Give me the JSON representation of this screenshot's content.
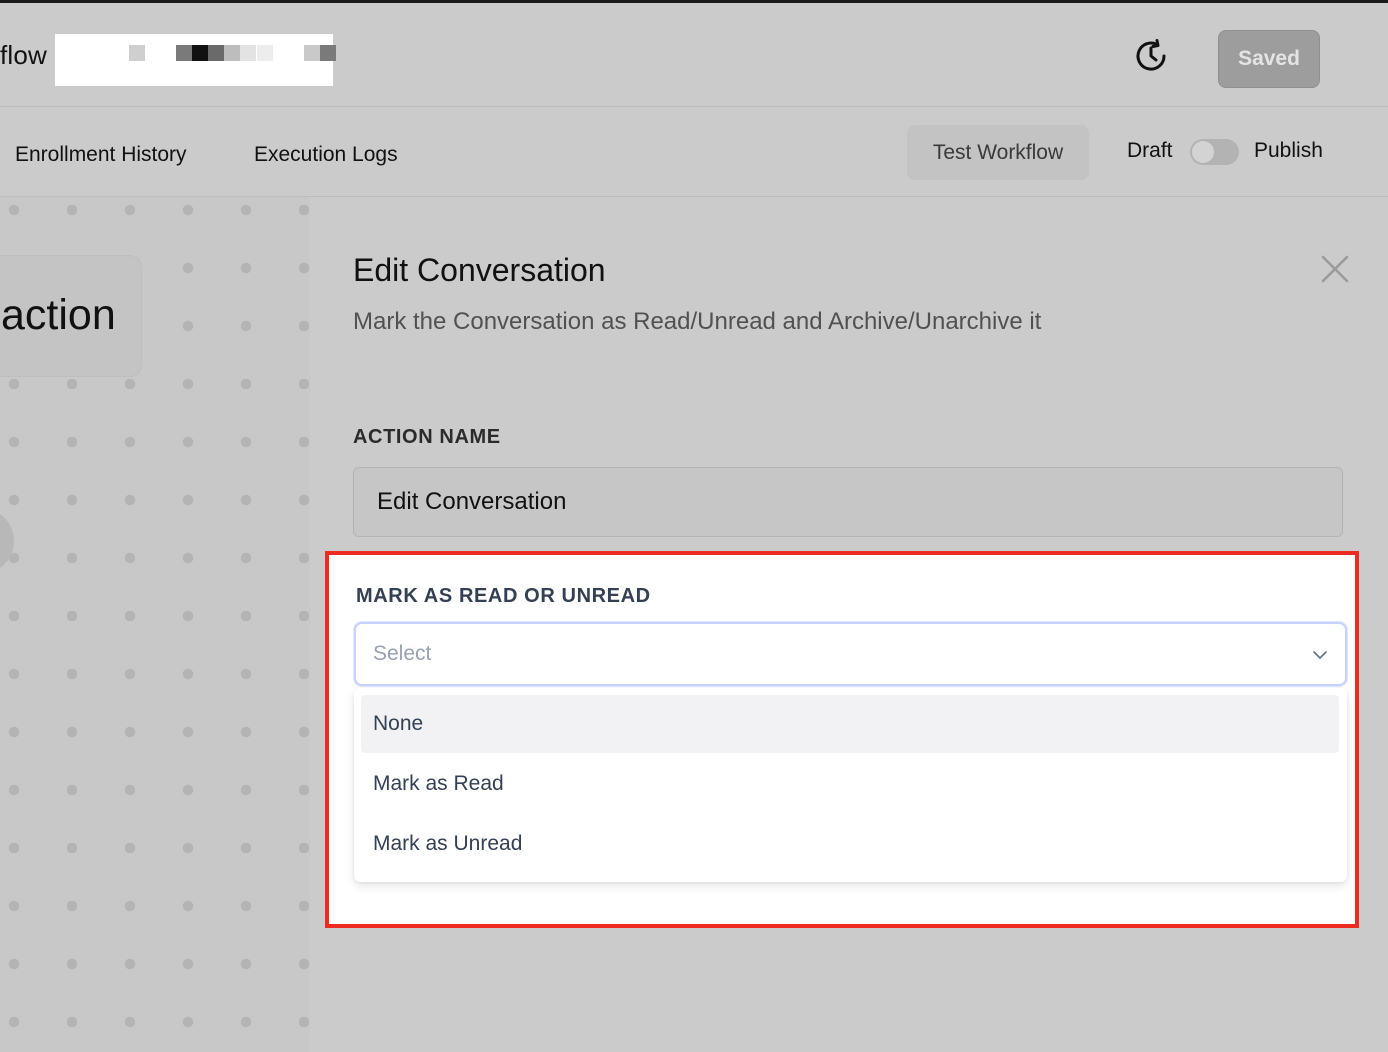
{
  "header": {
    "app_title_partial": "flow",
    "saved_label": "Saved",
    "history_icon": "history-clock-icon"
  },
  "subnav": {
    "tabs": [
      {
        "label": "Enrollment History"
      },
      {
        "label": "Execution Logs"
      }
    ],
    "test_workflow_label": "Test Workflow",
    "draft_label": "Draft",
    "publish_label": "Publish",
    "publish_toggle_on": false
  },
  "canvas": {
    "node_label_partial": "action"
  },
  "drawer": {
    "title": "Edit Conversation",
    "subtitle": "Mark the Conversation as Read/Unread and Archive/Unarchive it",
    "close_icon": "close-icon",
    "action_name_label": "ACTION NAME",
    "action_name_value": "Edit Conversation",
    "mark_label": "MARK AS READ OR UNREAD",
    "select_placeholder": "Select",
    "options": [
      {
        "label": "None",
        "highlighted": true
      },
      {
        "label": "Mark as Read",
        "highlighted": false
      },
      {
        "label": "Mark as Unread",
        "highlighted": false
      }
    ]
  },
  "colors": {
    "highlight_border": "#ee2b22",
    "overlay_background": "#cbcbcb",
    "select_focus_border": "#c7d2fe",
    "option_hover_bg": "#f2f2f5"
  }
}
